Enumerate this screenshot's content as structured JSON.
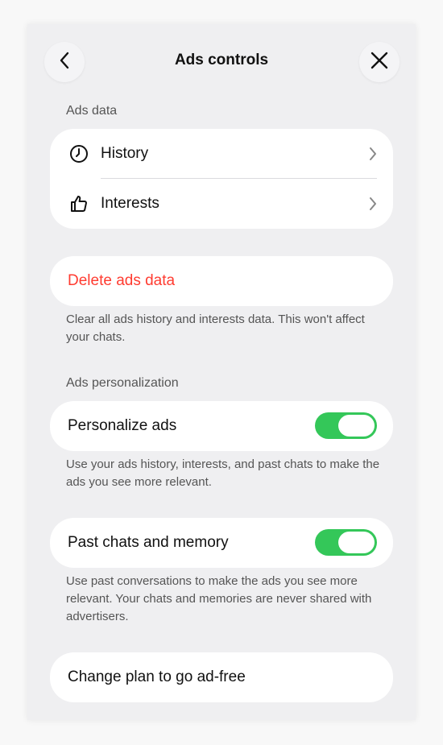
{
  "header": {
    "title": "Ads controls",
    "back_icon": "chevron-left-icon",
    "close_icon": "close-icon"
  },
  "ads_data": {
    "section_label": "Ads data",
    "items": [
      {
        "label": "History",
        "icon": "clock-icon"
      },
      {
        "label": "Interests",
        "icon": "thumbs-up-icon"
      }
    ]
  },
  "delete": {
    "label": "Delete ads data",
    "color": "#ff3b30",
    "description": "Clear all ads history and interests data. This won't affect your chats."
  },
  "personalization": {
    "section_label": "Ads personalization",
    "personalize": {
      "label": "Personalize ads",
      "enabled": true,
      "description": "Use your ads history, interests, and past chats to make the ads you see more relevant."
    },
    "memory": {
      "label": "Past chats and memory",
      "enabled": true,
      "description": "Use past conversations to make the ads you see more relevant. Your chats and memories are never shared with advertisers."
    }
  },
  "plan": {
    "label": "Change plan to go ad-free"
  },
  "colors": {
    "toggle_on": "#34c759",
    "background": "#efeff1",
    "card": "#ffffff"
  }
}
